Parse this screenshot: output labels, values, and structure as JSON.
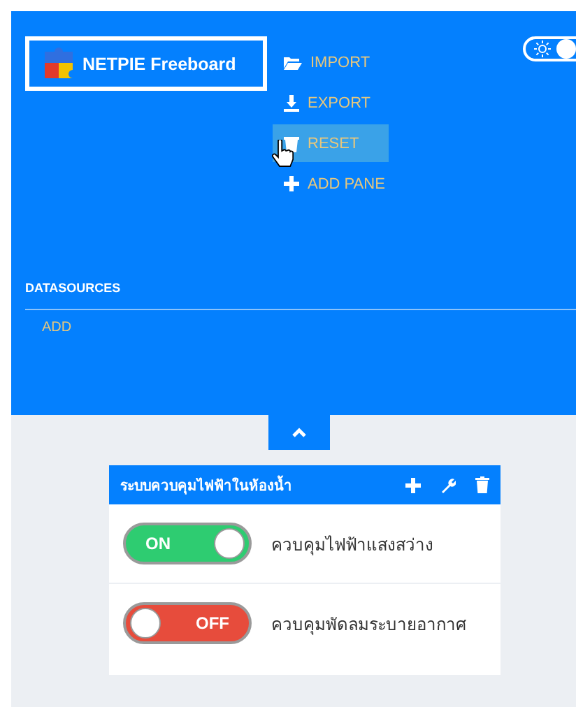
{
  "header": {
    "logo": {
      "title": "NETPIE Freeboard"
    },
    "menu": [
      {
        "label": "IMPORT",
        "hovered": false
      },
      {
        "label": "EXPORT",
        "hovered": false
      },
      {
        "label": "RESET",
        "hovered": true
      },
      {
        "label": "ADD PANE",
        "hovered": false
      }
    ],
    "theme_toggle": {
      "on": true
    },
    "datasources": {
      "title": "DATASOURCES",
      "add": "ADD"
    }
  },
  "pane": {
    "title": "ระบบควบคุมไฟฟ้าในห้องน้ำ",
    "rows": [
      {
        "on": true,
        "switch_label": "ON",
        "label": "ควบคุมไฟฟ้าแสงสว่าง"
      },
      {
        "on": false,
        "switch_label": "OFF",
        "label": "ควบคุมพัดลมระบายอากาศ"
      }
    ]
  }
}
